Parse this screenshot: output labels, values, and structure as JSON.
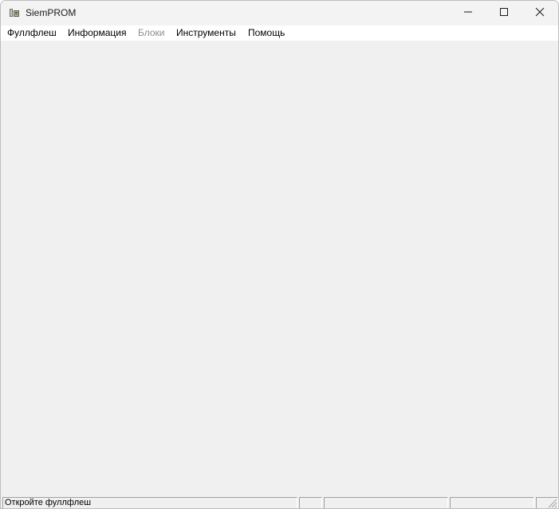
{
  "window": {
    "title": "SiemPROM",
    "app_icon": "siemprom-app-icon",
    "controls": {
      "minimize_icon": "minimize-icon",
      "maximize_icon": "maximize-icon",
      "close_icon": "close-icon"
    }
  },
  "menu": {
    "items": [
      {
        "label": "Фуллфлеш",
        "enabled": true
      },
      {
        "label": "Информация",
        "enabled": true
      },
      {
        "label": "Блоки",
        "enabled": false
      },
      {
        "label": "Инструменты",
        "enabled": true
      },
      {
        "label": "Помощь",
        "enabled": true
      }
    ]
  },
  "statusbar": {
    "panels": [
      "Откройте фуллфлеш",
      "",
      "",
      "",
      ""
    ],
    "grip_icon": "resize-grip-icon"
  },
  "colors": {
    "background": "#f0f0f0",
    "menubar": "#ffffff",
    "disabled_text": "#8d8d8d"
  }
}
